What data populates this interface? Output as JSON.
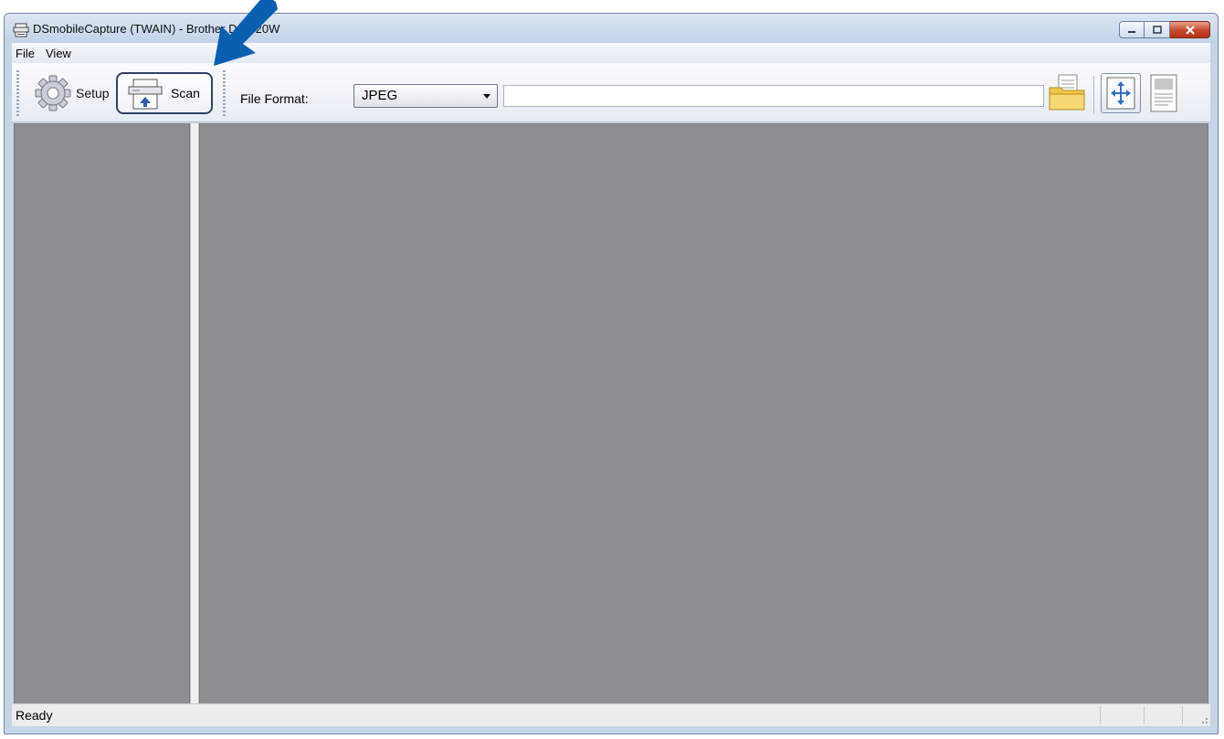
{
  "window": {
    "title": "DSmobileCapture (TWAIN) - Brother DS-820W"
  },
  "menu": {
    "file": "File",
    "view": "View"
  },
  "toolbar": {
    "setup_label": "Setup",
    "scan_label": "Scan",
    "file_format_label": "File Format:",
    "file_format_value": "JPEG",
    "file_path_value": ""
  },
  "status": {
    "text": "Ready"
  },
  "colors": {
    "callout_arrow": "#0b5fb0",
    "pane_background": "#8d8e91"
  },
  "icons": {
    "title": "scanner-icon",
    "setup": "gear-icon",
    "scan": "scanner-icon",
    "browse": "folder-icon",
    "fit": "fit-to-window-icon",
    "page": "page-icon"
  }
}
